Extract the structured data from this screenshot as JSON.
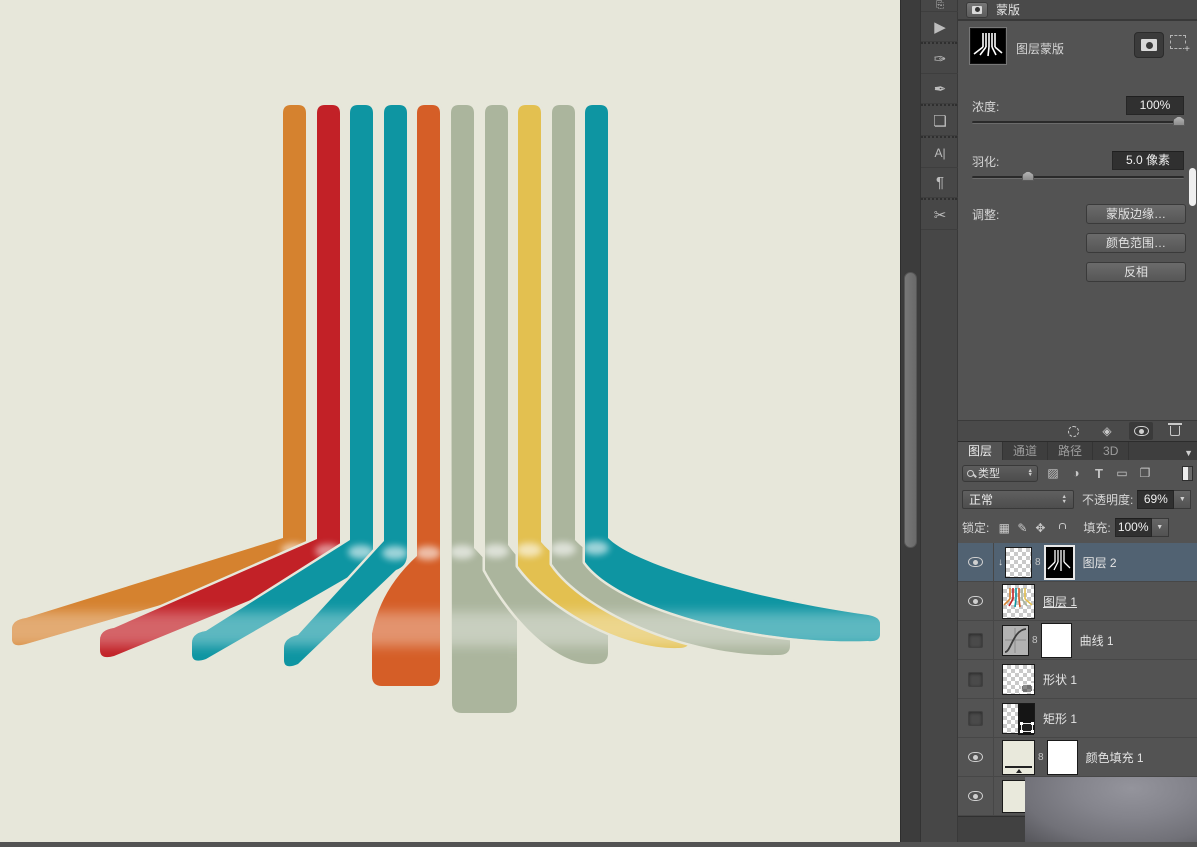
{
  "artwork": {
    "background": "#E7E7DA",
    "description": "retro ribbon stripes bending and fanning out",
    "stripes": [
      {
        "name": "orange",
        "color": "#D5822F"
      },
      {
        "name": "red",
        "color": "#C22127"
      },
      {
        "name": "teal",
        "color": "#0E95A2"
      },
      {
        "name": "teal",
        "color": "#0E95A2"
      },
      {
        "name": "vermilion",
        "color": "#D55E27"
      },
      {
        "name": "sage",
        "color": "#ABB59D"
      },
      {
        "name": "sage",
        "color": "#ABB59D"
      },
      {
        "name": "yellow",
        "color": "#E3C050"
      },
      {
        "name": "sage",
        "color": "#ABB59D"
      },
      {
        "name": "teal",
        "color": "#0E95A2"
      }
    ]
  },
  "masks_panel": {
    "title": "蒙版",
    "layer_mask_label": "图层蒙版",
    "density_label": "浓度:",
    "density_value": "100%",
    "feather_label": "羽化:",
    "feather_value": "5.0 像素",
    "adjust_label": "调整:",
    "mask_edge_button": "蒙版边缘…",
    "color_range_button": "颜色范围…",
    "invert_button": "反相"
  },
  "layers_panel": {
    "tabs": [
      {
        "label": "图层"
      },
      {
        "label": "通道"
      },
      {
        "label": "路径"
      },
      {
        "label": "3D"
      }
    ],
    "filter_label": "类型",
    "blend_mode": "正常",
    "opacity_label": "不透明度:",
    "opacity_value": "69%",
    "lock_label": "锁定:",
    "fill_label": "填充:",
    "fill_value": "100%",
    "layers": [
      {
        "name": "图层 2",
        "visible": true,
        "selected": true
      },
      {
        "name": "图层 1",
        "visible": true,
        "selected": false
      },
      {
        "name": "曲线 1",
        "visible": false,
        "selected": false
      },
      {
        "name": "形状 1",
        "visible": false,
        "selected": false
      },
      {
        "name": "矩形 1",
        "visible": false,
        "selected": false
      },
      {
        "name": "颜色填充 1",
        "visible": true,
        "selected": false
      },
      {
        "name": "",
        "visible": true,
        "selected": false
      }
    ]
  }
}
